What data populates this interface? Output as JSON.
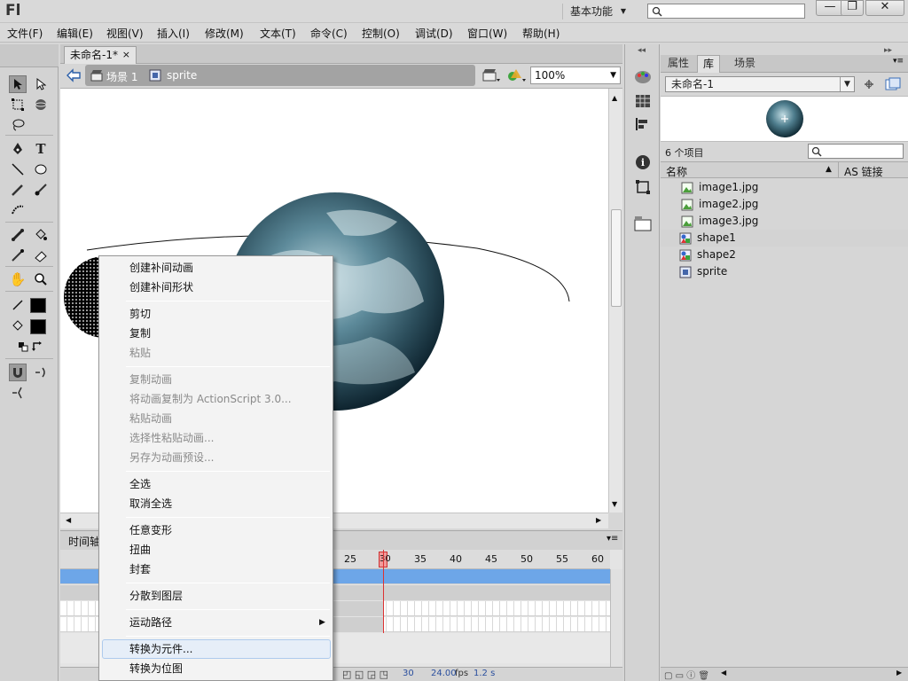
{
  "app": {
    "logo": "Fl",
    "workspace": "基本功能"
  },
  "window_buttons": {
    "minimize": "—",
    "maximize": "❐",
    "close": "✕"
  },
  "menubar": [
    "文件(F)",
    "编辑(E)",
    "视图(V)",
    "插入(I)",
    "修改(M)",
    "文本(T)",
    "命令(C)",
    "控制(O)",
    "调试(D)",
    "窗口(W)",
    "帮助(H)"
  ],
  "document": {
    "tab_label": "未命名-1*",
    "tab_close": "×",
    "breadcrumbs": [
      "场景 1",
      "sprite"
    ],
    "zoom": "100%"
  },
  "timeline": {
    "label": "时间轴",
    "frame_numbers": [
      "25",
      "30",
      "35",
      "40",
      "45",
      "50",
      "55",
      "60"
    ],
    "current_frame": "30",
    "status": {
      "frame": "30",
      "fps": "24.00",
      "fps_unit": "fps",
      "time": "1.2 s"
    }
  },
  "context_menu": {
    "items": [
      {
        "label": "创建补间动画",
        "enabled": true
      },
      {
        "label": "创建补间形状",
        "enabled": true
      },
      {
        "label": "剪切",
        "enabled": true
      },
      {
        "label": "复制",
        "enabled": true
      },
      {
        "label": "粘贴",
        "enabled": false
      },
      {
        "label": "复制动画",
        "enabled": false
      },
      {
        "label": "将动画复制为 ActionScript 3.0...",
        "enabled": false
      },
      {
        "label": "粘贴动画",
        "enabled": false
      },
      {
        "label": "选择性粘贴动画...",
        "enabled": false
      },
      {
        "label": "另存为动画预设...",
        "enabled": false
      },
      {
        "label": "全选",
        "enabled": true
      },
      {
        "label": "取消全选",
        "enabled": true
      },
      {
        "label": "任意变形",
        "enabled": true
      },
      {
        "label": "扭曲",
        "enabled": true
      },
      {
        "label": "封套",
        "enabled": true
      },
      {
        "label": "分散到图层",
        "enabled": true
      },
      {
        "label": "运动路径",
        "enabled": true,
        "submenu": true
      },
      {
        "label": "转换为元件...",
        "enabled": true,
        "highlighted": true
      },
      {
        "label": "转换为位图",
        "enabled": true
      }
    ]
  },
  "panel": {
    "tabs": [
      "属性",
      "库",
      "场景"
    ],
    "active_tab": "库",
    "library": {
      "document": "未命名-1",
      "item_count": "6 个项目",
      "columns": {
        "name": "名称",
        "linkage": "AS 链接"
      },
      "items": [
        {
          "name": "image1.jpg",
          "type": "bitmap"
        },
        {
          "name": "image2.jpg",
          "type": "bitmap"
        },
        {
          "name": "image3.jpg",
          "type": "bitmap"
        },
        {
          "name": "shape1",
          "type": "graphic"
        },
        {
          "name": "shape2",
          "type": "graphic"
        },
        {
          "name": "sprite",
          "type": "movieclip"
        }
      ]
    }
  }
}
